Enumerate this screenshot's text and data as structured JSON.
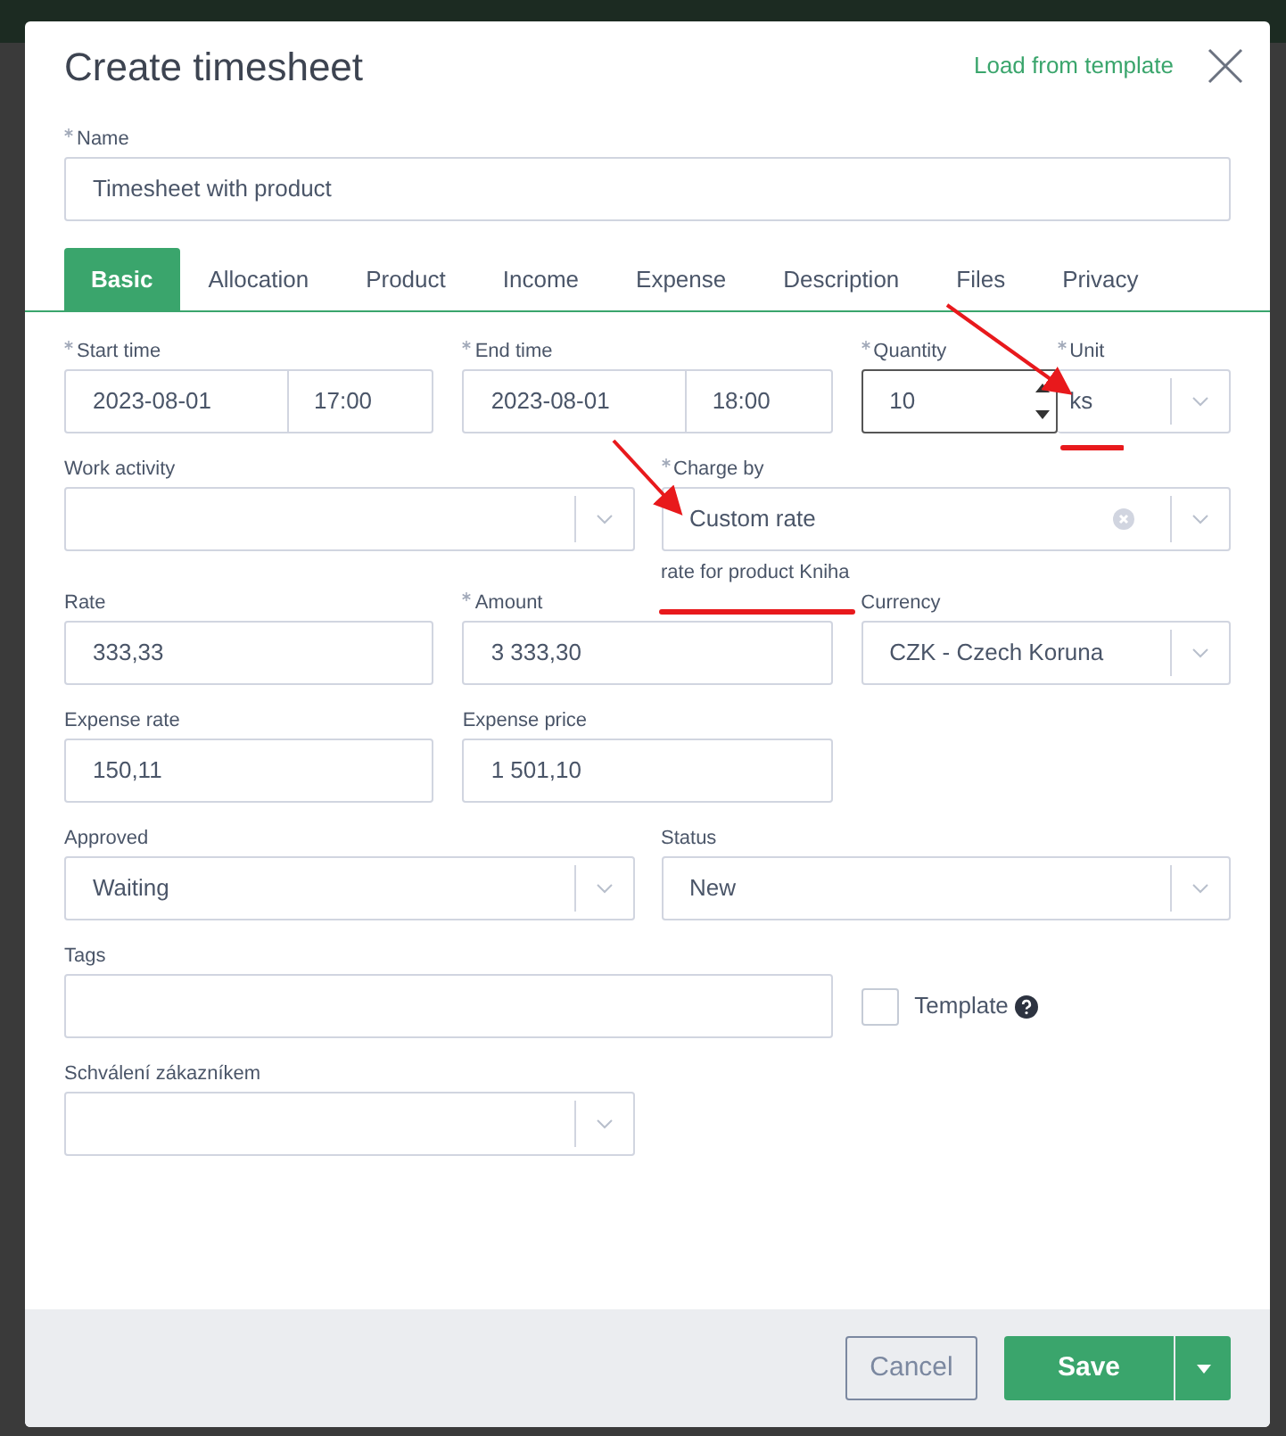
{
  "dialog": {
    "title": "Create timesheet",
    "load_link": "Load from template"
  },
  "name_field": {
    "label": "Name",
    "required": true,
    "value": "Timesheet with product"
  },
  "tabs": [
    {
      "label": "Basic",
      "selected": true
    },
    {
      "label": "Allocation",
      "selected": false
    },
    {
      "label": "Product",
      "selected": false
    },
    {
      "label": "Income",
      "selected": false
    },
    {
      "label": "Expense",
      "selected": false
    },
    {
      "label": "Description",
      "selected": false
    },
    {
      "label": "Files",
      "selected": false
    },
    {
      "label": "Privacy",
      "selected": false
    }
  ],
  "rows": [
    [
      {
        "kind": "datetime",
        "label": "Start time",
        "required": true,
        "date": "2023-08-01",
        "time": "17:00"
      },
      {
        "kind": "datetime",
        "label": "End time",
        "required": true,
        "date": "2023-08-01",
        "time": "18:00"
      },
      {
        "kind": "quantity",
        "label": "Quantity",
        "required": true,
        "value": "10",
        "focused": true,
        "unit_label": "Unit",
        "unit_required": true,
        "unit": "ks"
      }
    ],
    [
      {
        "kind": "select",
        "label": "Work activity",
        "required": false
      },
      {
        "kind": "select",
        "label": "Charge by",
        "required": true,
        "value": "Custom rate",
        "clearable": true,
        "hint": "rate for product Kniha"
      }
    ],
    [
      {
        "kind": "text",
        "label": "Rate",
        "required": false,
        "value": "333,33"
      },
      {
        "kind": "text",
        "label": "Amount",
        "required": true,
        "value": "3 333,30"
      },
      {
        "kind": "select",
        "label": "Currency",
        "required": false,
        "value": "CZK - Czech Koruna"
      }
    ],
    [
      {
        "kind": "text",
        "label": "Expense rate",
        "required": false,
        "value": "150,11"
      },
      {
        "kind": "text",
        "label": "Expense price",
        "required": false,
        "value": "1 501,10"
      }
    ],
    [
      {
        "kind": "select",
        "label": "Approved",
        "required": false,
        "value": "Waiting"
      },
      {
        "kind": "select",
        "label": "Status",
        "required": false,
        "value": "New"
      }
    ],
    [
      {
        "kind": "tags",
        "label": "Tags",
        "required": false
      },
      {
        "kind": "checkbox",
        "label": "Template",
        "checked": false,
        "help": true
      }
    ],
    [
      {
        "kind": "select",
        "label": "Schválení zákazníkem",
        "required": false
      }
    ]
  ],
  "footer": {
    "cancel": "Cancel",
    "save": "Save"
  }
}
